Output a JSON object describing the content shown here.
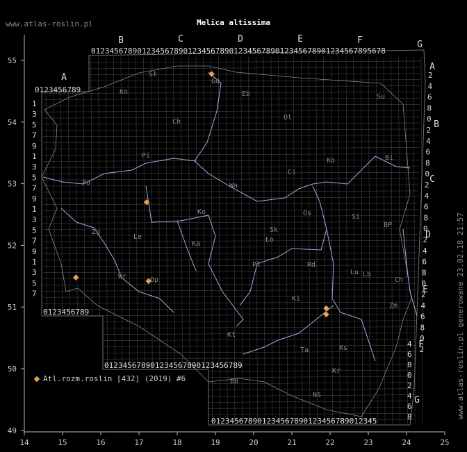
{
  "watermark": "www.atlas-roslin.pl",
  "title": "Melica altissima",
  "credit": "www.atlas-roslin.pl generowane 23.02.18 21:57",
  "legend": {
    "label": "Atl.rozm.roslin [432] (2019) #6",
    "color": "#f4a040"
  },
  "axes": {
    "x_ticks": [
      "14",
      "15",
      "16",
      "17",
      "18",
      "19",
      "20",
      "21",
      "22",
      "23",
      "24",
      "25"
    ],
    "y_ticks": [
      "55",
      "54",
      "53",
      "52",
      "51",
      "50",
      "49"
    ]
  },
  "grid_letters_top": [
    "A",
    "B",
    "C",
    "D",
    "E",
    "F",
    "G"
  ],
  "grid_letters_right": [
    "A",
    "B",
    "C",
    "D",
    "E",
    "F",
    "G"
  ],
  "grid_digits": "0123456789",
  "region_codes": [
    "Sł",
    "Gd",
    "Ko",
    "Eb",
    "Su",
    "Ol",
    "Ch",
    "Bi",
    "Pi",
    "Ci",
    "Ko",
    "Wa",
    "Os",
    "Po",
    "Ko",
    "Ło",
    "Sk",
    "BP",
    "Zg",
    "Le",
    "Ka",
    "Lu",
    "Si",
    "Pl",
    "Rd",
    "Lb",
    "Ch",
    "Wr",
    "Op",
    "Ki",
    "Zm",
    "Kt",
    "Ta",
    "Ks",
    "Kr",
    "BB",
    "NS"
  ],
  "localities": [
    {
      "lon": 18.9,
      "lat": 54.78
    },
    {
      "lon": 17.2,
      "lat": 52.7
    },
    {
      "lon": 15.35,
      "lat": 51.48
    },
    {
      "lon": 17.25,
      "lat": 51.42
    },
    {
      "lon": 21.9,
      "lat": 50.98
    },
    {
      "lon": 21.9,
      "lat": 50.88
    }
  ],
  "colors": {
    "grid": "#707070",
    "rivers": "#9bb0e6",
    "borders": "#8a8a8a",
    "axis": "#bbbbbb"
  }
}
